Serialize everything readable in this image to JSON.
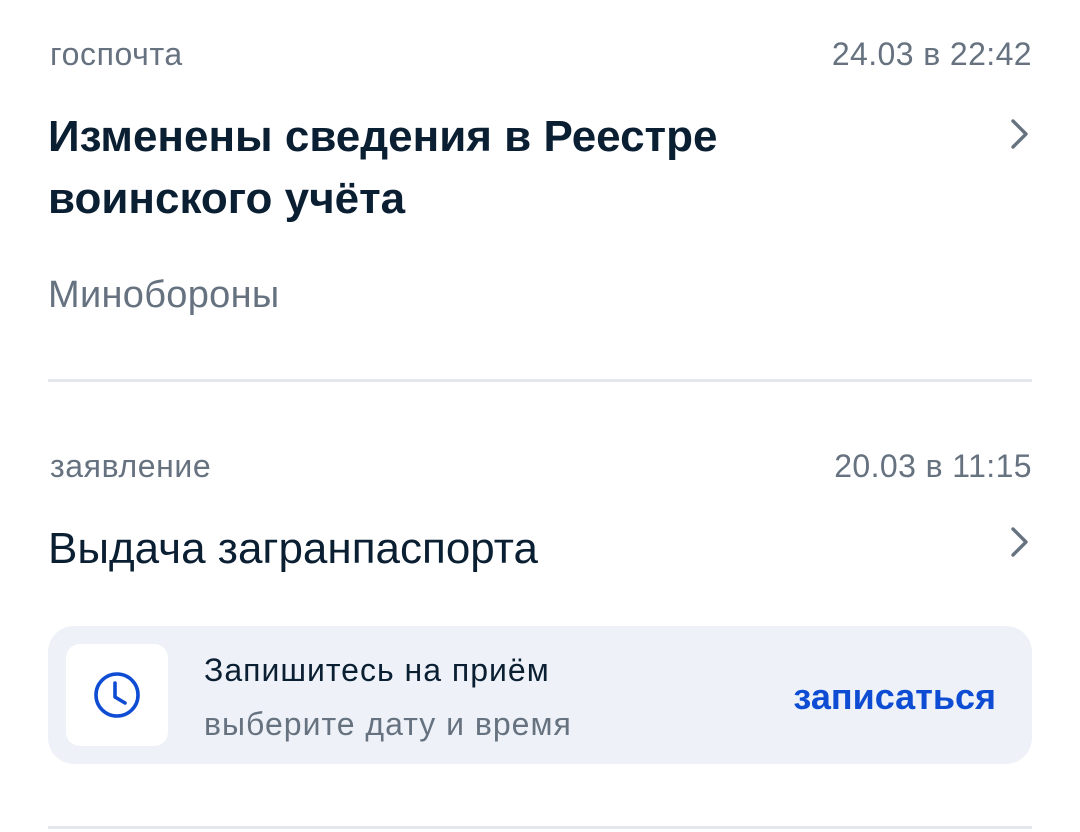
{
  "notifications": [
    {
      "category": "госпочта",
      "datetime": "24.03 в 22:42",
      "title_line1": "Изменены сведения в Реестре",
      "title_line2": "воинского учёта",
      "sender": "Минобороны",
      "chevron_icon": "chevron-right-icon",
      "unread": true
    },
    {
      "category": "заявление",
      "datetime": "20.03 в 11:15",
      "title": "Выдача загранпаспорта",
      "chevron_icon": "chevron-right-icon",
      "appointment": {
        "icon": "clock-icon",
        "title": "Запишитесь на приём",
        "subtitle": "выберите дату и время",
        "action_label": "записаться"
      }
    }
  ],
  "colors": {
    "text_primary": "#0b1f33",
    "text_secondary": "#66727f",
    "accent": "#0d4cd3",
    "card_bg": "#eef2f8",
    "divider": "#e4e8ee"
  }
}
